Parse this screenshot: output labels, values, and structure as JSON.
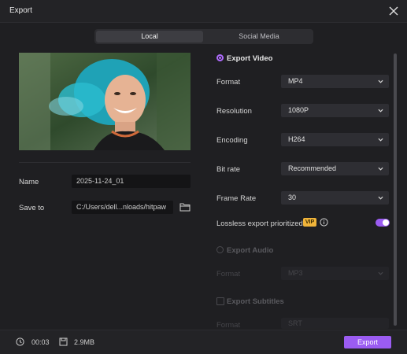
{
  "window": {
    "title": "Export"
  },
  "tabs": {
    "local": "Local",
    "social": "Social Media"
  },
  "file": {
    "name_label": "Name",
    "name_value": "2025-11-24_01",
    "save_label": "Save to",
    "save_value": "C:/Users/dell...nloads/hitpaw"
  },
  "export_video": {
    "title": "Export Video",
    "format_label": "Format",
    "format_value": "MP4",
    "resolution_label": "Resolution",
    "resolution_value": "1080P",
    "encoding_label": "Encoding",
    "encoding_value": "H264",
    "bitrate_label": "Bit rate",
    "bitrate_value": "Recommended",
    "framerate_label": "Frame Rate",
    "framerate_value": "30",
    "lossless_label": "Lossless export prioritized",
    "vip_badge": "VIP"
  },
  "export_audio": {
    "title": "Export Audio",
    "format_label": "Format",
    "format_value": "MP3"
  },
  "export_subtitles": {
    "title": "Export Subtitles",
    "format_label": "Format",
    "format_value": "SRT"
  },
  "footer": {
    "duration": "00:03",
    "size": "2.9MB",
    "export_button": "Export"
  },
  "colors": {
    "accent": "#9b5cf2",
    "vip": "#f0b43a"
  }
}
